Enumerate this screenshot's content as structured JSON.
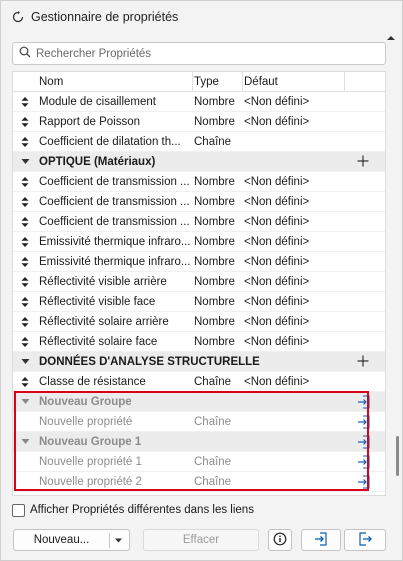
{
  "window": {
    "title": "Gestionnaire de propriétés"
  },
  "search": {
    "placeholder": "Rechercher Propriétés"
  },
  "table": {
    "columns": {
      "name": "Nom",
      "type": "Type",
      "default": "Défaut"
    },
    "rows": [
      {
        "kind": "prop",
        "name": "Module de cisaillement",
        "type": "Nombre",
        "default": "<Non défini>"
      },
      {
        "kind": "prop",
        "name": "Rapport de Poisson",
        "type": "Nombre",
        "default": "<Non défini>"
      },
      {
        "kind": "prop",
        "name": "Coefficient de dilatation th...",
        "type": "Chaîne",
        "default": ""
      },
      {
        "kind": "group",
        "name": "OPTIQUE (Matériaux)",
        "icon": "plus-icon"
      },
      {
        "kind": "prop",
        "name": "Coefficient de transmission ...",
        "type": "Nombre",
        "default": "<Non défini>"
      },
      {
        "kind": "prop",
        "name": "Coefficient de transmission ...",
        "type": "Nombre",
        "default": "<Non défini>"
      },
      {
        "kind": "prop",
        "name": "Coefficient de transmission ...",
        "type": "Nombre",
        "default": "<Non défini>"
      },
      {
        "kind": "prop",
        "name": "Emissivité thermique infraro...",
        "type": "Nombre",
        "default": "<Non défini>"
      },
      {
        "kind": "prop",
        "name": "Emissivité thermique infraro...",
        "type": "Nombre",
        "default": "<Non défini>"
      },
      {
        "kind": "prop",
        "name": "Réflectivité visible arrière",
        "type": "Nombre",
        "default": "<Non défini>"
      },
      {
        "kind": "prop",
        "name": "Réflectivité visible face",
        "type": "Nombre",
        "default": "<Non défini>"
      },
      {
        "kind": "prop",
        "name": "Réflectivité solaire arrière",
        "type": "Nombre",
        "default": "<Non défini>"
      },
      {
        "kind": "prop",
        "name": "Réflectivité solaire face",
        "type": "Nombre",
        "default": "<Non défini>"
      },
      {
        "kind": "group",
        "name": "DONNÉES D'ANALYSE STRUCTURELLE",
        "icon": "plus-icon"
      },
      {
        "kind": "prop",
        "name": "Classe de résistance",
        "type": "Chaîne",
        "default": "<Non défini>"
      },
      {
        "kind": "newgroup",
        "name": "Nouveau Groupe",
        "icon": "import-icon"
      },
      {
        "kind": "newprop",
        "name": "Nouvelle propriété",
        "type": "Chaîne",
        "default": "",
        "icon": "import-icon"
      },
      {
        "kind": "newgroup",
        "name": "Nouveau Groupe 1",
        "icon": "import-icon"
      },
      {
        "kind": "newprop",
        "name": "Nouvelle propriété 1",
        "type": "Chaîne",
        "default": "",
        "icon": "import-icon"
      },
      {
        "kind": "newprop",
        "name": "Nouvelle propriété 2",
        "type": "Chaîne",
        "default": "",
        "icon": "import-icon"
      }
    ]
  },
  "options": {
    "show_diff_label": "Afficher Propriétés différentes dans les liens"
  },
  "buttons": {
    "new_label": "Nouveau...",
    "delete_label": "Effacer"
  },
  "colors": {
    "highlight": "#d9001b"
  }
}
